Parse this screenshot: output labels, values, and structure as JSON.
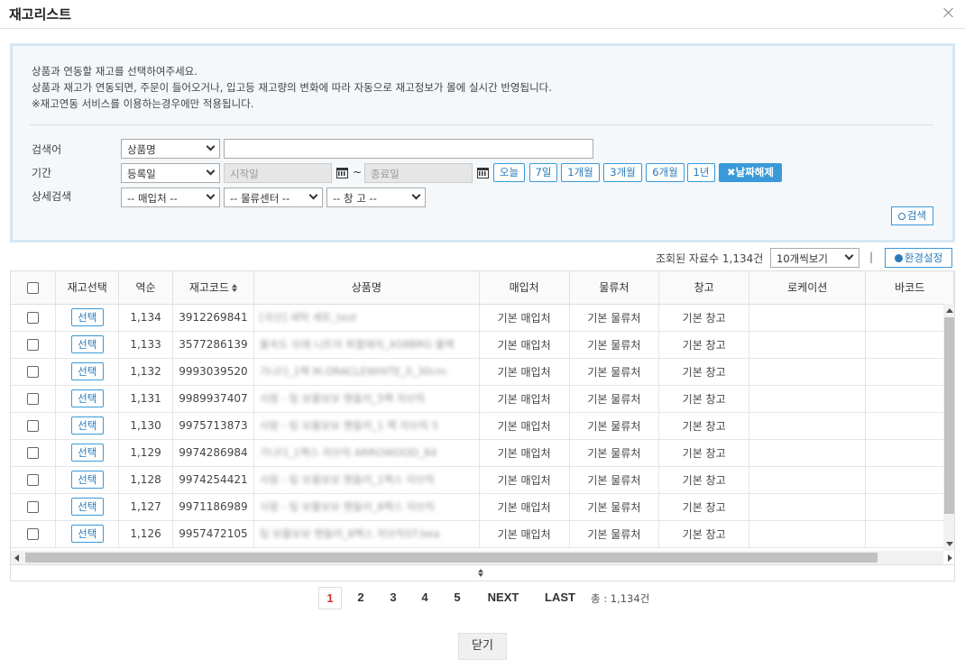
{
  "window": {
    "title": "재고리스트"
  },
  "notice": {
    "line1": "상품과 연동할 재고를 선택하여주세요.",
    "line2": "상품과 재고가 연동되면, 주문이 들어오거나, 입고등 재고량의 변화에 따라 자동으로 재고정보가 몰에 실시간 반영됩니다.",
    "line3": "※재고연동 서비스를 이용하는경우에만 적용됩니다."
  },
  "search": {
    "keyword_label": "검색어",
    "keyword_type": "상품명",
    "keyword_value": "",
    "period_label": "기간",
    "period_type": "등록일",
    "start_placeholder": "시작일",
    "tilde": "~",
    "end_placeholder": "종료일",
    "period_buttons": [
      "오늘",
      "7일",
      "1개월",
      "3개월",
      "6개월",
      "1년"
    ],
    "clear_date": "✖날짜해제",
    "detail_label": "상세검색",
    "supplier": "-- 매입처 --",
    "logistics": "-- 물류센터 --",
    "warehouse": "-- 창 고 --",
    "search_button": "검색"
  },
  "toolbar": {
    "result_text": "조회된 자료수 1,134건",
    "per_page": "10개씩보기",
    "separator": "|",
    "settings_button": "환경설정"
  },
  "table": {
    "headers": [
      "재고선택",
      "역순",
      "재고코드",
      "상품명",
      "매입처",
      "물류처",
      "창고",
      "로케이션",
      "바코드"
    ],
    "select_label": "선택",
    "rows": [
      {
        "num": "1,134",
        "code": "3912269841",
        "name": "[국산] 세탁 세트_test",
        "supplier": "기본 매입처",
        "logistics": "기본 물류처",
        "warehouse": "기본 창고"
      },
      {
        "num": "1,133",
        "code": "3577286139",
        "name": "불속도 브레 니트자 파할애자_A58BRG 블랙",
        "supplier": "기본 매입처",
        "logistics": "기본 물류처",
        "warehouse": "기본 창고"
      },
      {
        "num": "1,132",
        "code": "9993039520",
        "name": "가나다_1팩 M.ORACLEWHITE_0_30cm",
        "supplier": "기본 매입처",
        "logistics": "기본 물류처",
        "warehouse": "기본 창고"
      },
      {
        "num": "1,131",
        "code": "9989937407",
        "name": "사람 - 팀 보물보보 핸들러_5팩 자브릭",
        "supplier": "기본 매입처",
        "logistics": "기본 물류처",
        "warehouse": "기본 창고"
      },
      {
        "num": "1,130",
        "code": "9975713873",
        "name": "사람 - 팀 보물보보 핸들러_1 팩 자브릭 5",
        "supplier": "기본 매입처",
        "logistics": "기본 물류처",
        "warehouse": "기본 창고"
      },
      {
        "num": "1,129",
        "code": "9974286984",
        "name": "가나다_1팩스 자브릭 ARROWOOD_84",
        "supplier": "기본 매입처",
        "logistics": "기본 물류처",
        "warehouse": "기본 창고"
      },
      {
        "num": "1,128",
        "code": "9974254421",
        "name": "사람 - 팀 보물보보 핸들러_1팩스 자브릭",
        "supplier": "기본 매입처",
        "logistics": "기본 물류처",
        "warehouse": "기본 창고"
      },
      {
        "num": "1,127",
        "code": "9971186989",
        "name": "사람 - 팀 보물보보 핸들러_8팩스 자브릭",
        "supplier": "기본 매입처",
        "logistics": "기본 물류처",
        "warehouse": "기본 창고"
      },
      {
        "num": "1,126",
        "code": "9957472105",
        "name": "팀 보물보보 핸들러_8팩스 자브릭ST.bea",
        "supplier": "기본 매입처",
        "logistics": "기본 물류처",
        "warehouse": "기본 창고"
      }
    ]
  },
  "pagination": {
    "pages": [
      "1",
      "2",
      "3",
      "4",
      "5"
    ],
    "next": "NEXT",
    "last": "LAST",
    "total": "총 : 1,134건"
  },
  "footer": {
    "close_button": "닫기"
  },
  "colors": {
    "accent": "#3a9ad9",
    "active_page": "#d9322b",
    "panel_border": "#d6e7f3"
  }
}
